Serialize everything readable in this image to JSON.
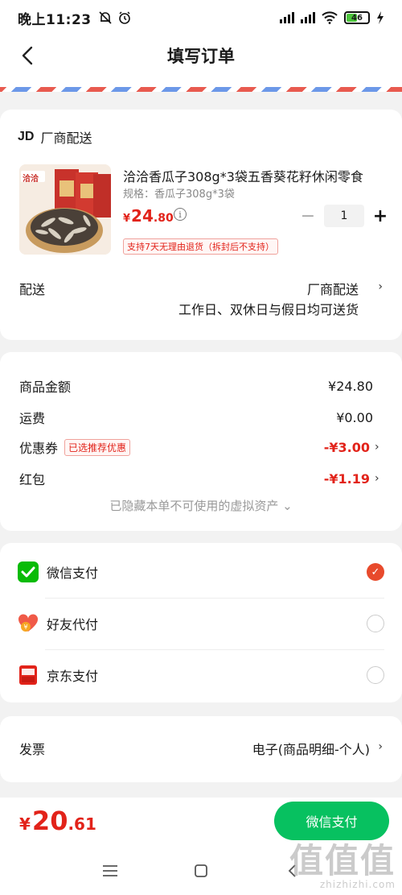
{
  "status_bar": {
    "time": "晚上11:23",
    "battery": "46"
  },
  "nav": {
    "title": "填写订单"
  },
  "shop": {
    "logo": "JD",
    "name": "厂商配送",
    "product": {
      "image_brand": "洽洽",
      "title": "洽洽香瓜子308g*3袋五香葵花籽休闲零食",
      "spec": "规格：香瓜子308g*3袋",
      "price_symbol": "¥",
      "price_int": "24",
      "price_dec": ".80",
      "quantity": "1",
      "return_policy": "支持7天无理由退货（拆封后不支持）"
    },
    "shipping": {
      "label": "配送",
      "method": "厂商配送",
      "note": "工作日、双休日与假日均可送货"
    }
  },
  "summary": {
    "goods": {
      "label": "商品金额",
      "value": "¥24.80"
    },
    "freight": {
      "label": "运费",
      "value": "¥0.00"
    },
    "coupon": {
      "label": "优惠券",
      "tag": "已选推荐优惠",
      "value": "-¥3.00"
    },
    "red_packet": {
      "label": "红包",
      "value": "-¥1.19"
    },
    "hidden_assets": "已隐藏本单不可使用的虚拟资产 ⌄"
  },
  "payment": {
    "options": [
      {
        "label": "微信支付",
        "icon": "wechat-pay-icon",
        "selected": true
      },
      {
        "label": "好友代付",
        "icon": "friend-pay-icon",
        "selected": false
      },
      {
        "label": "京东支付",
        "icon": "jd-pay-icon",
        "selected": false
      }
    ]
  },
  "invoice": {
    "label": "发票",
    "value": "电子(商品明细-个人)"
  },
  "checkout": {
    "total_symbol": "¥",
    "total_int": "20",
    "total_dec": ".61",
    "button_label": "微信支付"
  },
  "watermark": {
    "big": "值值值",
    "small": "zhizhizhi.com"
  },
  "colors": {
    "accent_red": "#e2231a",
    "wechat_green": "#07c160",
    "radio_selected": "#e84a2c"
  }
}
